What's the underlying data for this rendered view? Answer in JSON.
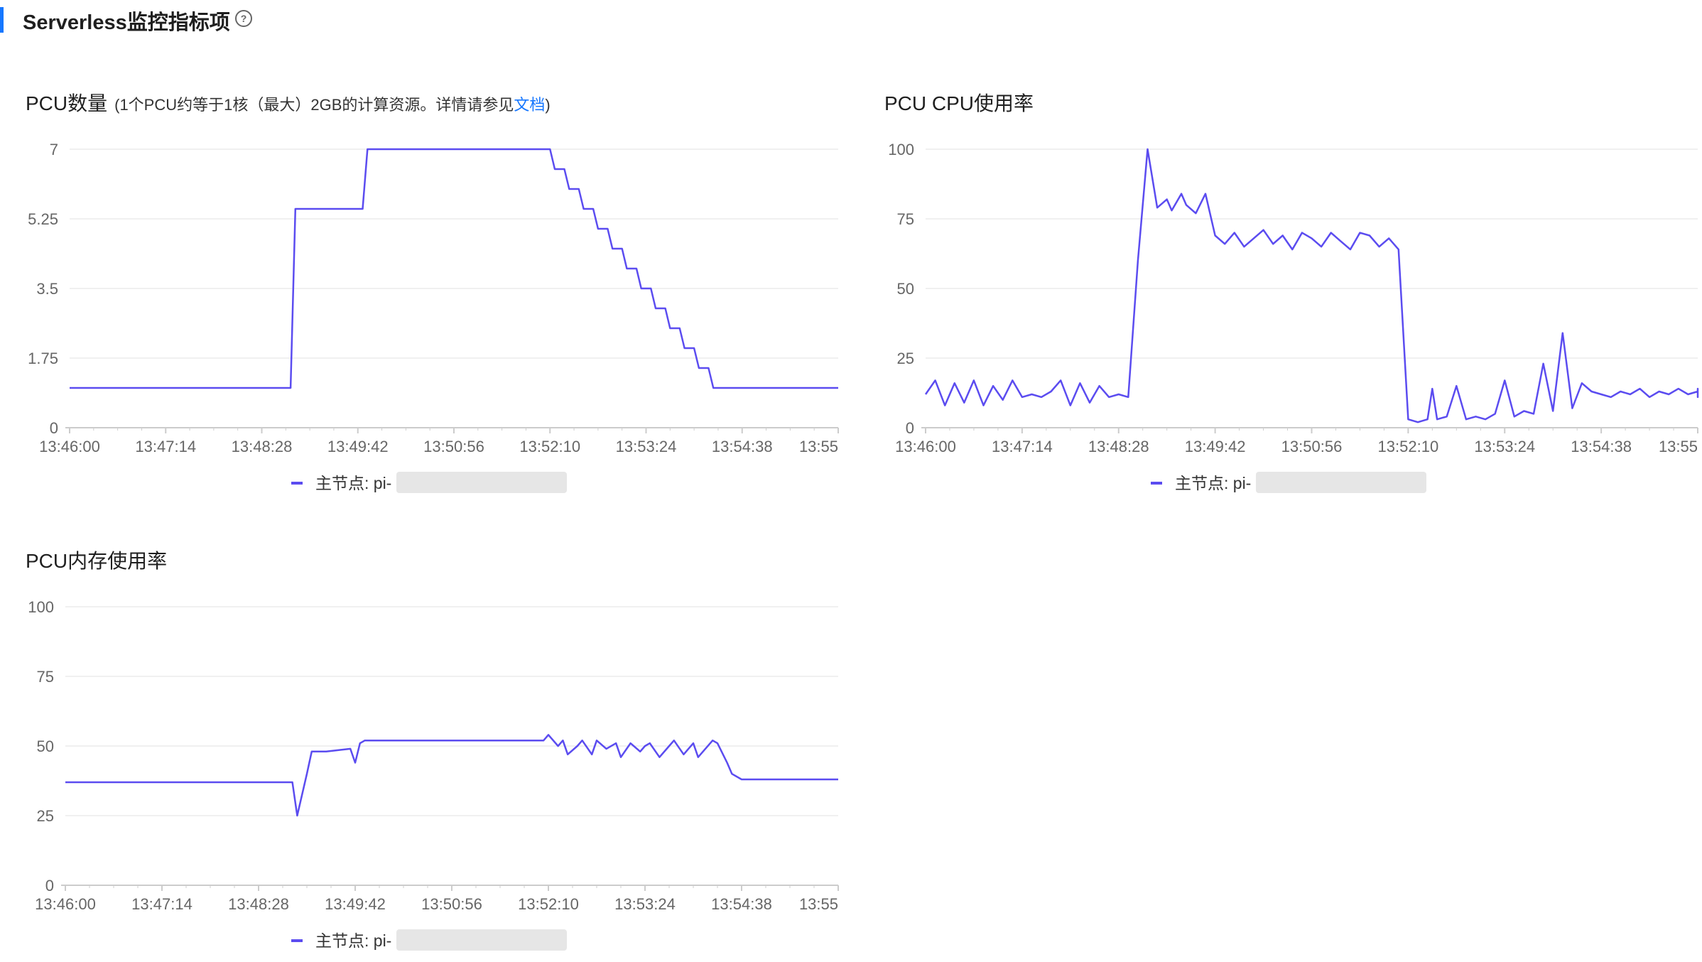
{
  "section": {
    "title": "Serverless监控指标项",
    "help_icon": "question-circle-icon"
  },
  "colors": {
    "accent": "#1677ff",
    "series": "#5b4cf0",
    "grid": "#ececec",
    "axis": "#cccccc"
  },
  "chart_data": [
    {
      "id": "pcu-count",
      "type": "line",
      "title": "PCU数量",
      "subtitle_prefix": "(1个PCU约等于1核（最大）2GB的计算资源。详情请参见",
      "subtitle_link": "文档",
      "subtitle_suffix": ")",
      "ylim": [
        0,
        7
      ],
      "yticks": [
        "0",
        "1.75",
        "3.5",
        "5.25",
        "7"
      ],
      "xticks": [
        "13:46:00",
        "13:47:14",
        "13:48:28",
        "13:49:42",
        "13:50:56",
        "13:52:10",
        "13:53:24",
        "13:54:38",
        "13:55"
      ],
      "grid": true,
      "legend_position": "bottom",
      "series": [
        {
          "name": "主节点: pi-",
          "x": [
            0,
            2.3,
            2.35,
            3.05,
            3.1,
            5.0,
            5.05,
            5.15,
            5.2,
            5.3,
            5.35,
            5.45,
            5.5,
            5.6,
            5.65,
            5.75,
            5.8,
            5.9,
            5.95,
            6.05,
            6.1,
            6.2,
            6.25,
            6.35,
            6.4,
            6.5,
            6.55,
            6.65,
            6.7,
            6.8,
            6.85,
            7.0,
            7.05,
            8.8
          ],
          "values": [
            1,
            1,
            5.5,
            5.5,
            7,
            7,
            6.5,
            6.5,
            6,
            6,
            5.5,
            5.5,
            5,
            5,
            4.5,
            4.5,
            4,
            4,
            3.5,
            3.5,
            3,
            3,
            2.5,
            2.5,
            2,
            2,
            1.5,
            1.5,
            1,
            1,
            1,
            1,
            1,
            1
          ]
        }
      ]
    },
    {
      "id": "pcu-cpu",
      "type": "line",
      "title": "PCU CPU使用率",
      "ylim": [
        0,
        100
      ],
      "yticks": [
        "0",
        "25",
        "50",
        "75",
        "100"
      ],
      "xticks": [
        "13:46:00",
        "13:47:14",
        "13:48:28",
        "13:49:42",
        "13:50:56",
        "13:52:10",
        "13:53:24",
        "13:54:38",
        "13:55"
      ],
      "grid": true,
      "legend_position": "bottom",
      "series": [
        {
          "name": "主节点: pi-",
          "x": [
            0,
            0.1,
            0.2,
            0.3,
            0.4,
            0.5,
            0.6,
            0.7,
            0.8,
            0.9,
            1.0,
            1.1,
            1.2,
            1.3,
            1.4,
            1.5,
            1.6,
            1.7,
            1.8,
            1.9,
            2.0,
            2.1,
            2.2,
            2.3,
            2.4,
            2.5,
            2.55,
            2.6,
            2.65,
            2.7,
            2.8,
            2.9,
            3.0,
            3.1,
            3.2,
            3.3,
            3.4,
            3.5,
            3.6,
            3.7,
            3.8,
            3.9,
            4.0,
            4.1,
            4.2,
            4.3,
            4.4,
            4.5,
            4.6,
            4.7,
            4.8,
            4.9,
            5.0,
            5.1,
            5.2,
            5.25,
            5.3,
            5.4,
            5.5,
            5.6,
            5.7,
            5.8,
            5.9,
            6.0,
            6.1,
            6.2,
            6.3,
            6.4,
            6.5,
            6.6,
            6.7,
            6.8,
            6.9,
            7.0,
            7.1,
            7.2,
            7.3,
            7.4,
            7.5,
            7.6,
            7.7,
            7.8,
            7.9,
            8.0,
            8.1,
            8.2,
            8.3,
            8.4,
            8.5,
            8.6,
            8.7,
            8.8
          ],
          "values": [
            12,
            17,
            8,
            16,
            9,
            17,
            8,
            15,
            10,
            17,
            11,
            12,
            11,
            13,
            17,
            8,
            16,
            9,
            15,
            11,
            12,
            11,
            60,
            100,
            79,
            82,
            78,
            81,
            84,
            80,
            77,
            84,
            69,
            66,
            70,
            65,
            68,
            71,
            66,
            69,
            64,
            70,
            68,
            65,
            70,
            67,
            64,
            70,
            69,
            65,
            68,
            64,
            3,
            2,
            3,
            14,
            3,
            4,
            15,
            3,
            4,
            3,
            5,
            17,
            4,
            6,
            5,
            23,
            6,
            34,
            7,
            16,
            13,
            12,
            11,
            13,
            12,
            14,
            11,
            13,
            12,
            14,
            12,
            13,
            11,
            12,
            14,
            12,
            13,
            11,
            12,
            14
          ]
        }
      ]
    },
    {
      "id": "pcu-memory",
      "type": "line",
      "title": "PCU内存使用率",
      "ylim": [
        0,
        100
      ],
      "yticks": [
        "0",
        "25",
        "50",
        "75",
        "100"
      ],
      "xticks": [
        "13:46:00",
        "13:47:14",
        "13:48:28",
        "13:49:42",
        "13:50:56",
        "13:52:10",
        "13:53:24",
        "13:54:38",
        "13:55"
      ],
      "grid": true,
      "legend_position": "bottom",
      "series": [
        {
          "name": "主节点: pi-",
          "x": [
            0,
            0.5,
            1.0,
            1.5,
            2.0,
            2.2,
            2.35,
            2.4,
            2.5,
            2.55,
            2.7,
            2.95,
            3.0,
            3.05,
            3.1,
            3.3,
            3.5,
            3.8,
            4.1,
            4.4,
            4.7,
            4.95,
            5.0,
            5.1,
            5.15,
            5.2,
            5.3,
            5.35,
            5.45,
            5.5,
            5.6,
            5.7,
            5.75,
            5.85,
            5.95,
            6.0,
            6.05,
            6.15,
            6.25,
            6.3,
            6.4,
            6.5,
            6.55,
            6.7,
            6.75,
            6.85,
            6.9,
            7.0,
            7.2,
            7.5,
            7.8,
            8.1,
            8.4,
            8.8
          ],
          "values": [
            37,
            37,
            37,
            37,
            37,
            37,
            37,
            25,
            40,
            48,
            48,
            49,
            44,
            51,
            52,
            52,
            52,
            52,
            52,
            52,
            52,
            52,
            54,
            50,
            52,
            47,
            50,
            52,
            47,
            52,
            49,
            51,
            46,
            51,
            48,
            50,
            51,
            46,
            50,
            52,
            47,
            51,
            46,
            52,
            51,
            44,
            40,
            38,
            38,
            38,
            38,
            38,
            38,
            38
          ]
        }
      ]
    }
  ]
}
